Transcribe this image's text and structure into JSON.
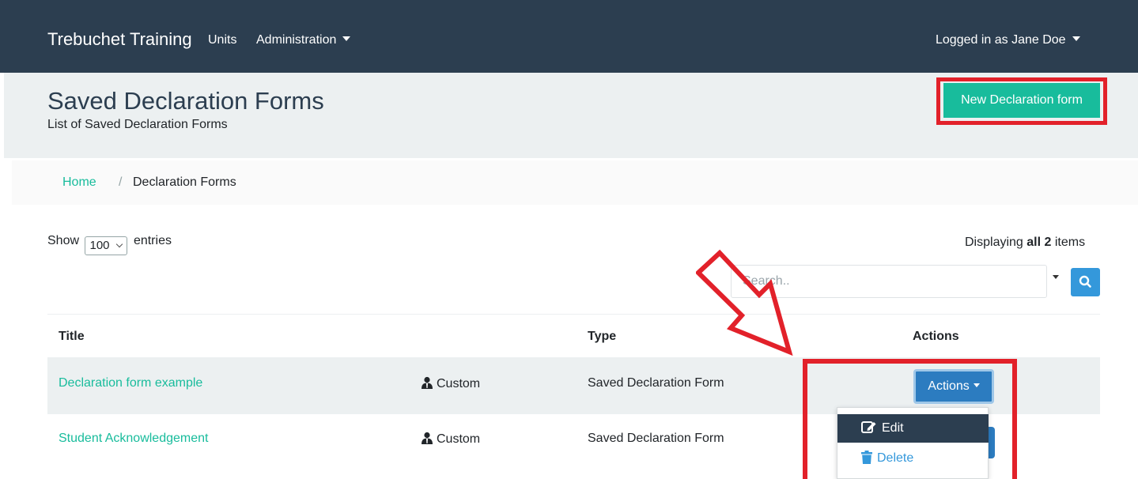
{
  "navbar": {
    "brand": "Trebuchet Training",
    "units": "Units",
    "administration": "Administration",
    "user": "Logged in as Jane Doe"
  },
  "header": {
    "title": "Saved Declaration Forms",
    "subtitle": "List of Saved Declaration Forms",
    "new_button": "New Declaration form"
  },
  "breadcrumb": {
    "home": "Home",
    "separator": "/",
    "current": "Declaration Forms"
  },
  "controls": {
    "show_label": "Show",
    "entries_value": "100",
    "entries_label": "entries",
    "displaying_prefix": "Displaying",
    "displaying_bold": "all 2",
    "displaying_suffix": "items",
    "search_placeholder": "Search.."
  },
  "table": {
    "headers": [
      "Title",
      "Type",
      "Actions"
    ],
    "rows": [
      {
        "title": "Declaration form example",
        "tag": "Custom",
        "type": "Saved Declaration Form"
      },
      {
        "title": "Student Acknowledgement",
        "tag": "Custom",
        "type": "Saved Declaration Form"
      }
    ]
  },
  "actions": {
    "button_label": "Actions",
    "menu": [
      "Edit",
      "Delete"
    ]
  },
  "colors": {
    "navbar": "#2c3e50",
    "accent_green": "#18bc9c",
    "primary_blue": "#3498db",
    "annotation_red": "#e2212a"
  }
}
